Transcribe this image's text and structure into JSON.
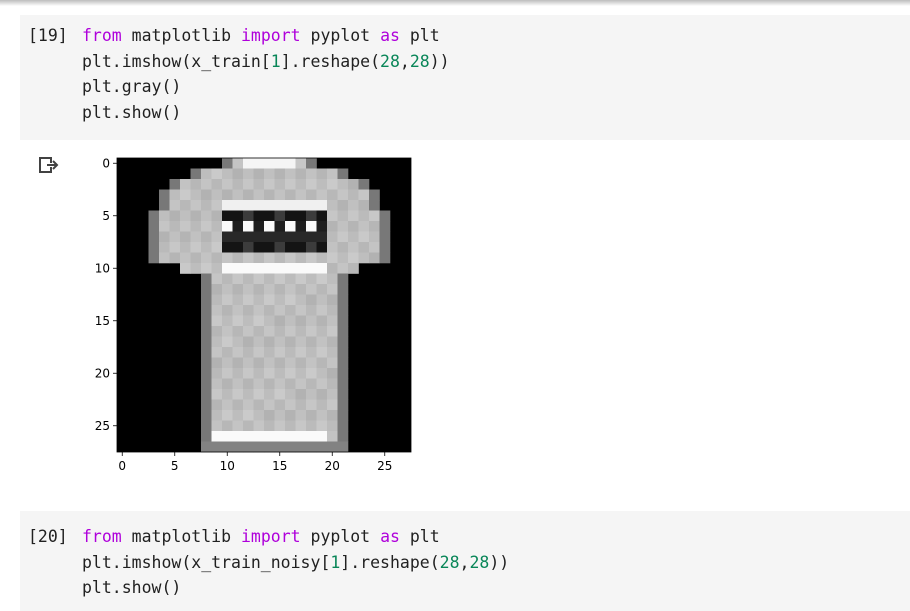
{
  "cells": [
    {
      "exec_count": "[19]",
      "lines": [
        [
          {
            "t": "from",
            "c": "kw"
          },
          {
            "t": " matplotlib ",
            "c": ""
          },
          {
            "t": "import",
            "c": "kw"
          },
          {
            "t": " pyplot ",
            "c": ""
          },
          {
            "t": "as",
            "c": "kw"
          },
          {
            "t": " plt",
            "c": ""
          }
        ],
        [
          {
            "t": "plt.imshow(x_train[",
            "c": ""
          },
          {
            "t": "1",
            "c": "num"
          },
          {
            "t": "].reshape(",
            "c": ""
          },
          {
            "t": "28",
            "c": "num"
          },
          {
            "t": ",",
            "c": ""
          },
          {
            "t": "28",
            "c": "num"
          },
          {
            "t": "))",
            "c": ""
          }
        ],
        [
          {
            "t": "plt.gray()",
            "c": ""
          }
        ],
        [
          {
            "t": "plt.show()",
            "c": ""
          }
        ]
      ]
    },
    {
      "exec_count": "[20]",
      "lines": [
        [
          {
            "t": "from",
            "c": "kw"
          },
          {
            "t": " matplotlib ",
            "c": ""
          },
          {
            "t": "import",
            "c": "kw"
          },
          {
            "t": " pyplot ",
            "c": ""
          },
          {
            "t": "as",
            "c": "kw"
          },
          {
            "t": " plt",
            "c": ""
          }
        ],
        [
          {
            "t": "plt.imshow(x_train_noisy[",
            "c": ""
          },
          {
            "t": "1",
            "c": "num"
          },
          {
            "t": "].reshape(",
            "c": ""
          },
          {
            "t": "28",
            "c": "num"
          },
          {
            "t": ",",
            "c": ""
          },
          {
            "t": "28",
            "c": "num"
          },
          {
            "t": "))",
            "c": ""
          }
        ],
        [
          {
            "t": "plt.show()",
            "c": ""
          }
        ]
      ]
    }
  ],
  "output": {
    "icon": "output-arrow-icon",
    "colors": {
      "icon": "#424242",
      "keyword": "#af00db",
      "number": "#098658"
    }
  },
  "chart_data": {
    "type": "heatmap",
    "colormap": "gray",
    "grid": false,
    "xlim": [
      -0.5,
      27.5
    ],
    "ylim": [
      27.5,
      -0.5
    ],
    "xticks": [
      "0",
      "5",
      "10",
      "15",
      "20",
      "25"
    ],
    "yticks": [
      "0",
      "5",
      "10",
      "15",
      "20",
      "25"
    ]
  }
}
